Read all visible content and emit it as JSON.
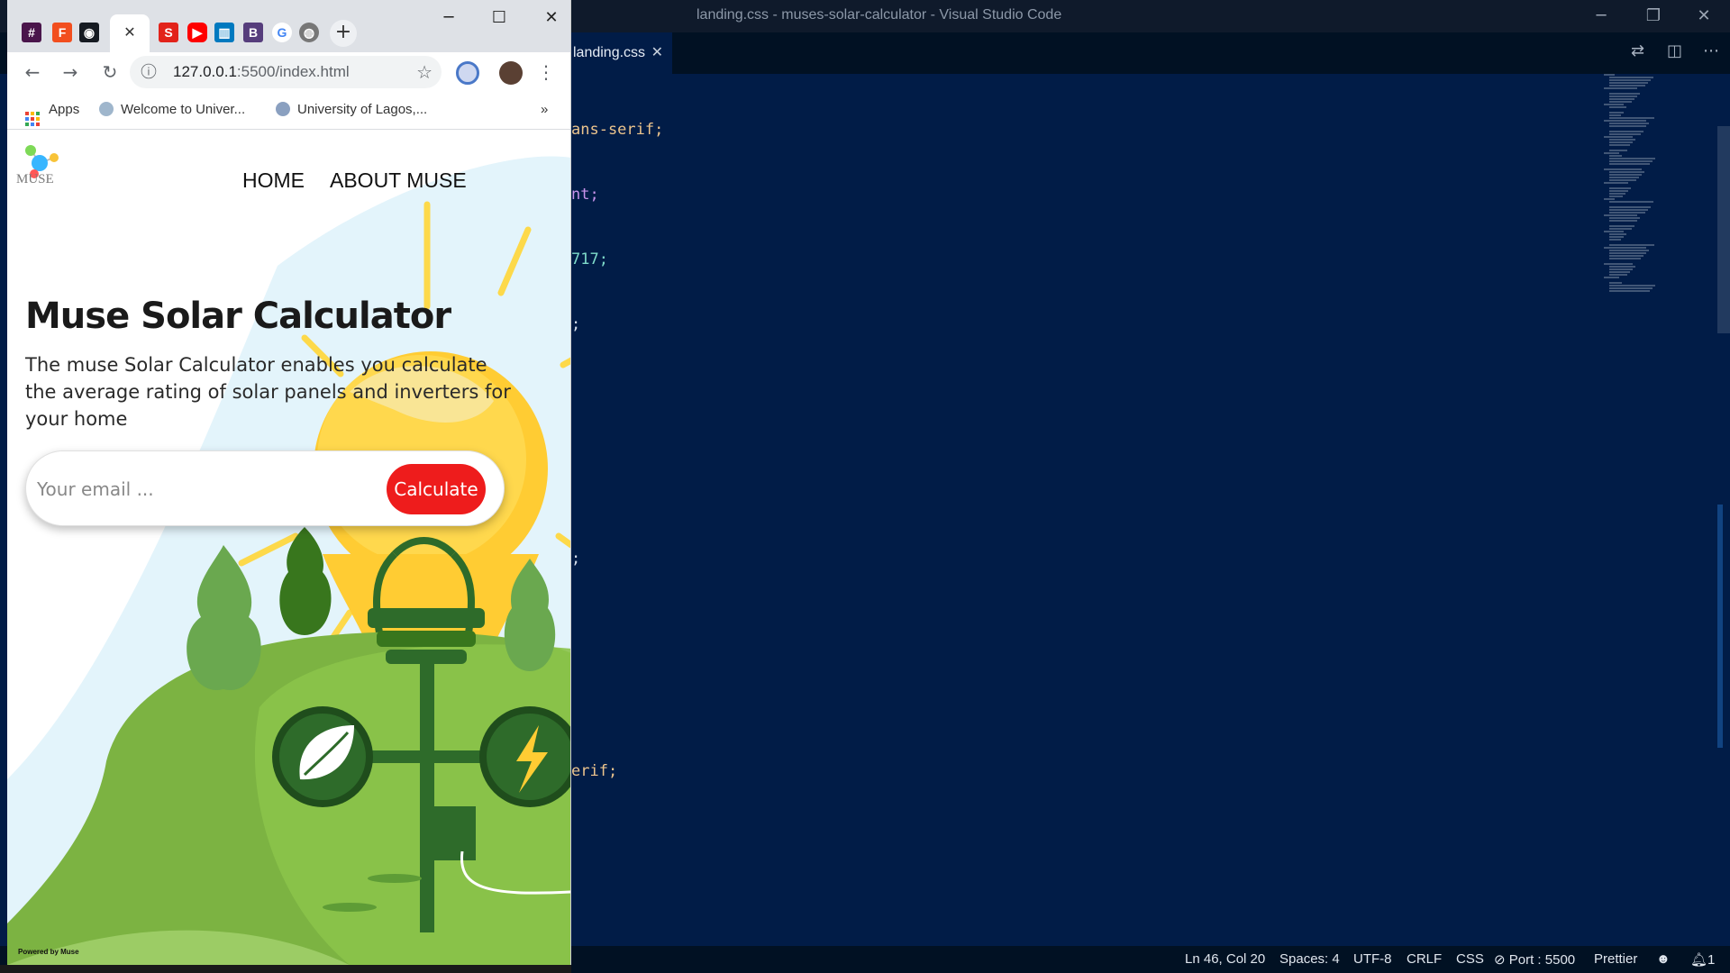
{
  "vscode": {
    "title": "landing.css - muses-solar-calculator - Visual Studio Code",
    "tab_label": "landing.css",
    "code_fragments": [
      {
        "text": "ans-serif;",
        "color": "#ecc48d"
      },
      {
        "text": "nt;",
        "color": "#c792ea"
      },
      {
        "text": "717;",
        "color": "#7fdbca"
      },
      {
        "text": ";",
        "color": "#d6deeb"
      },
      {
        "text": ";",
        "color": "#d6deeb"
      },
      {
        "text": "erif;",
        "color": "#ecc48d"
      }
    ],
    "status": {
      "position": "Ln 46, Col 20",
      "spaces": "Spaces: 4",
      "encoding": "UTF-8",
      "eol": "CRLF",
      "language": "CSS",
      "port": "Port : 5500",
      "formatter": "Prettier",
      "notifications": "1"
    }
  },
  "browser": {
    "active_tab_close": "✕",
    "new_tab": "+",
    "url_host": "127.0.0.1",
    "url_rest": ":5500/index.html",
    "bookmarks": {
      "apps": "Apps",
      "bm1": "Welcome to Univer...",
      "bm2": "University of Lagos,...",
      "more": "»"
    },
    "tab_icons": [
      "slack-icon",
      "figma-icon",
      "github-icon",
      "slides-icon",
      "youtube-icon",
      "trello-icon",
      "bootstrap-icon",
      "google-icon",
      "globe-icon"
    ]
  },
  "page": {
    "logo_text": "MUSE",
    "nav": {
      "home": "HOME",
      "about": "ABOUT MUSE"
    },
    "hero_title": "Muse Solar Calculator",
    "hero_text": "The muse Solar Calculator enables you calculate the average rating of solar panels and inverters for your home",
    "email_placeholder": "Your email ...",
    "calculate_label": "Calculate",
    "powered_by": "Powered by Muse"
  },
  "colors": {
    "calculate_button": "#ee1c1c",
    "editor_bg": "#011c47",
    "hill_green": "#6aa84f",
    "bulb_yellow": "#ffcc33"
  }
}
